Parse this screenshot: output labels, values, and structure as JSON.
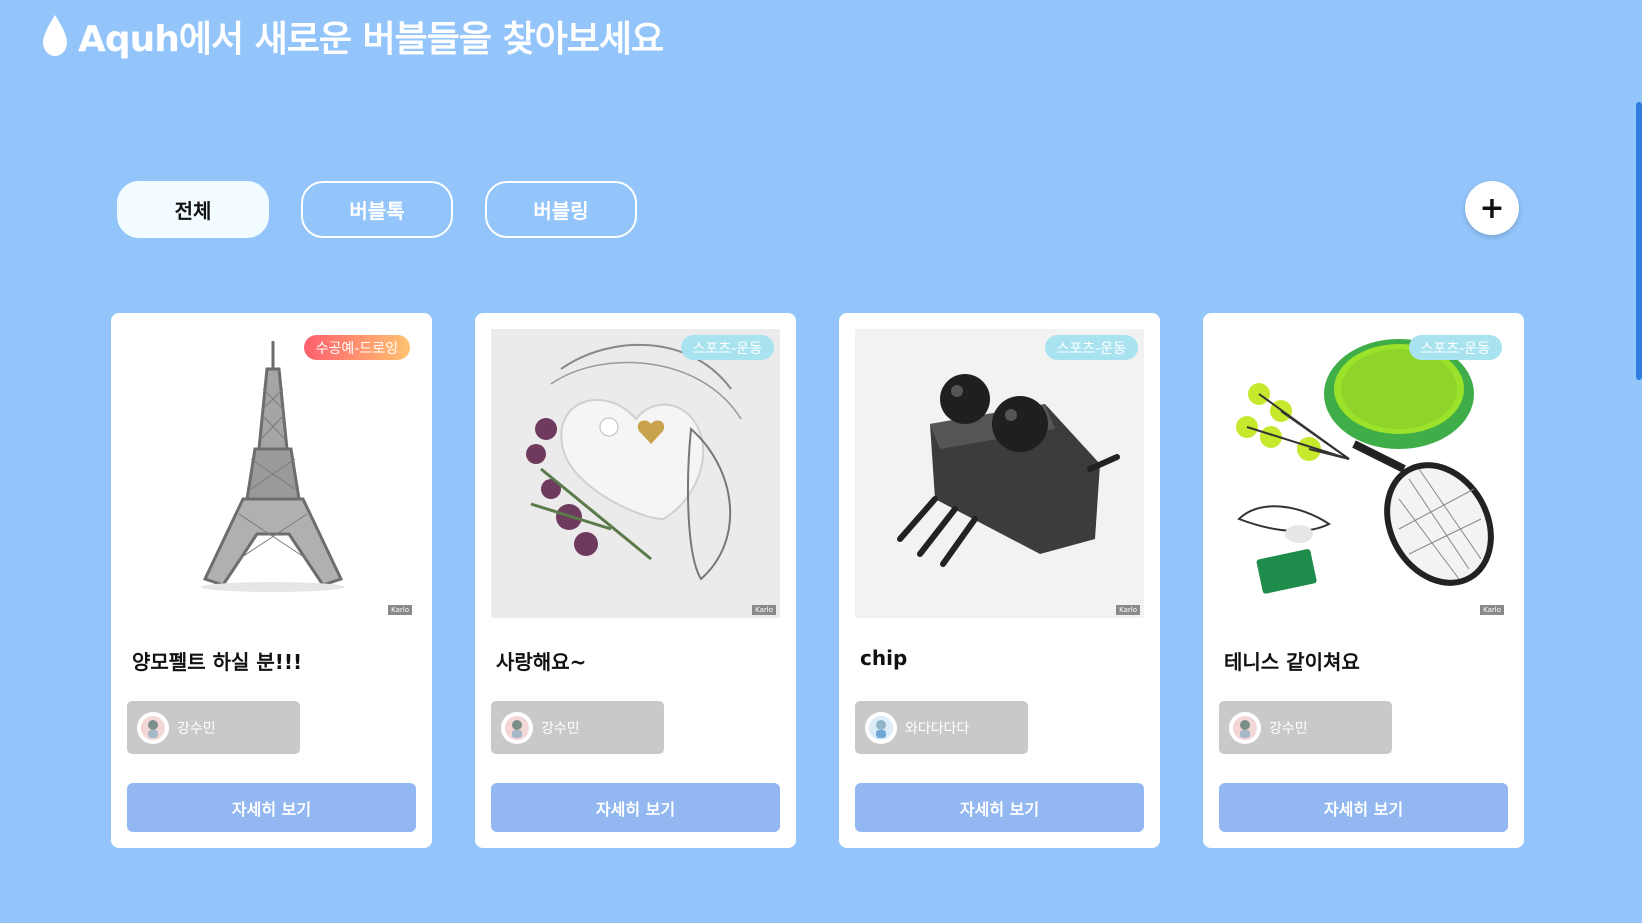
{
  "header": {
    "title": "Aquh에서 새로운 버블들을 찾아보세요",
    "icon": "water-drop-icon"
  },
  "filters": [
    {
      "label": "전체",
      "active": true
    },
    {
      "label": "버블톡",
      "active": false
    },
    {
      "label": "버블링",
      "active": false
    }
  ],
  "add_button": {
    "label": "+",
    "icon": "plus-icon"
  },
  "cards": [
    {
      "title": "양모펠트 하실 분!!!",
      "category": "수공예-드로잉",
      "author": "강수민",
      "button_label": "자세히 보기",
      "watermark": "Karlo",
      "image": "eiffel-tower-image"
    },
    {
      "title": "사랑해요~",
      "category": "스포츠-운동",
      "author": "강수민",
      "button_label": "자세히 보기",
      "watermark": "Karlo",
      "image": "heart-flowers-image"
    },
    {
      "title": "chip",
      "category": "스포츠-운동",
      "author": "와다다다다",
      "button_label": "자세히 보기",
      "watermark": "Karlo",
      "image": "chip-image"
    },
    {
      "title": "테니스 같이쳐요",
      "category": "스포츠-운동",
      "author": "강수민",
      "button_label": "자세히 보기",
      "watermark": "Karlo",
      "image": "tennis-gear-image"
    }
  ],
  "colors": {
    "background": "#93c5fb",
    "card": "#ffffff",
    "detail_button": "#93b7f1",
    "author_chip": "#c9c9c9",
    "badge_sport": "#a8e3ef",
    "badge_craft_start": "#ff5f6d",
    "badge_craft_end": "#ffc371"
  }
}
